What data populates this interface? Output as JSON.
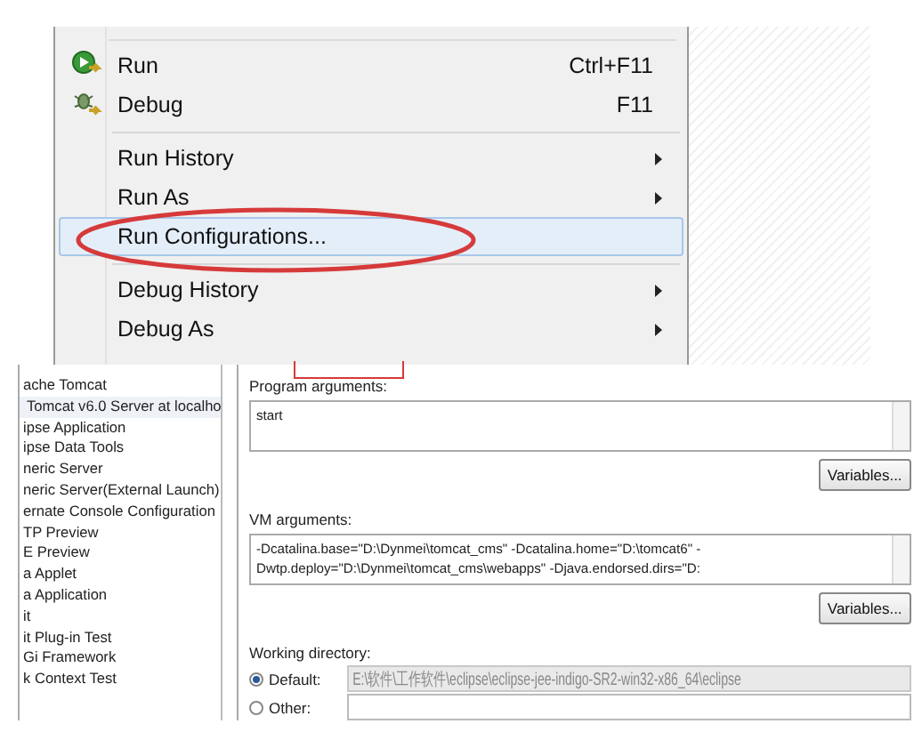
{
  "menu": {
    "items": [
      {
        "kind": "command",
        "label": "Run",
        "shortcut": "Ctrl+F11",
        "selected": false
      },
      {
        "kind": "command",
        "label": "Debug",
        "shortcut": "F11",
        "selected": false
      },
      {
        "kind": "separator"
      },
      {
        "kind": "submenu",
        "label": "Run History",
        "selected": false
      },
      {
        "kind": "submenu",
        "label": "Run As",
        "selected": false
      },
      {
        "kind": "command",
        "label": "Run Configurations...",
        "selected": true
      },
      {
        "kind": "separator"
      },
      {
        "kind": "submenu",
        "label": "Debug History",
        "selected": false
      },
      {
        "kind": "submenu",
        "label": "Debug As",
        "selected": false
      }
    ]
  },
  "launch_list": {
    "items": [
      {
        "label": "ache Tomcat",
        "selected": false
      },
      {
        "label": "Tomcat v6.0 Server at localho",
        "selected": true
      },
      {
        "label": "ipse Application",
        "selected": false
      },
      {
        "label": "ipse Data Tools",
        "selected": false
      },
      {
        "label": "neric Server",
        "selected": false
      },
      {
        "label": "neric Server(External Launch)",
        "selected": false
      },
      {
        "label": "ernate Console Configuration",
        "selected": false
      },
      {
        "label": "TP Preview",
        "selected": false
      },
      {
        "label": "E Preview",
        "selected": false
      },
      {
        "label": "a Applet",
        "selected": false
      },
      {
        "label": "a Application",
        "selected": false
      },
      {
        "label": "it",
        "selected": false
      },
      {
        "label": "it Plug-in Test",
        "selected": false
      },
      {
        "label": "Gi Framework",
        "selected": false
      },
      {
        "label": "k Context Test",
        "selected": false
      }
    ]
  },
  "program_arguments": {
    "label": "Program arguments:",
    "lines": [
      "start"
    ],
    "button": "Variables..."
  },
  "vm_arguments": {
    "label": "VM arguments:",
    "lines": [
      "-Dcatalina.base=\"D:\\Dynmei\\tomcat_cms\" -Dcatalina.home=\"D:\\tomcat6\" -",
      "Dwtp.deploy=\"D:\\Dynmei\\tomcat_cms\\webapps\" -Djava.endorsed.dirs=\"D:"
    ],
    "button": "Variables..."
  },
  "working_directory": {
    "label": "Working directory:",
    "options": [
      {
        "label": "Default:",
        "selected": true,
        "value": "E:\\软件\\工作软件\\eclipse\\eclipse-jee-indigo-SR2-win32-x86_64\\eclipse",
        "disabled": true
      },
      {
        "label": "Other:",
        "selected": false,
        "disabled": false
      }
    ]
  }
}
